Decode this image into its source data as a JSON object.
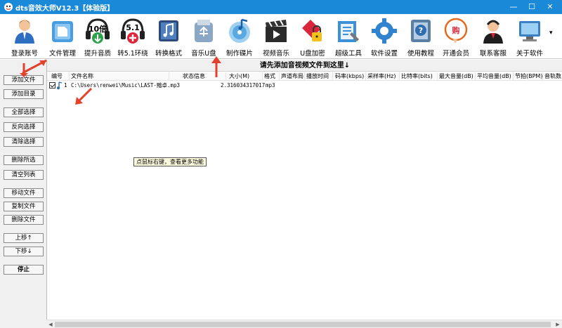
{
  "window": {
    "title": "dts音效大师V12.3【体验版】",
    "minimize_glyph": "—",
    "maximize_glyph": "☐",
    "close_glyph": "✕"
  },
  "toolbar": {
    "items": [
      {
        "label": "登录账号",
        "icon": "user-icon"
      },
      {
        "label": "文件管理",
        "icon": "folder-icon"
      },
      {
        "label": "提升音质",
        "icon": "headphones-10x-icon",
        "badge": "10倍"
      },
      {
        "label": "转5.1环绕",
        "icon": "headphones-51-icon",
        "badge": "5.1"
      },
      {
        "label": "转换格式",
        "icon": "music-note-icon"
      },
      {
        "label": "音乐U盘",
        "icon": "usb-drive-icon"
      },
      {
        "label": "制作碟片",
        "icon": "cd-disc-icon"
      },
      {
        "label": "视频音乐",
        "icon": "clapperboard-icon"
      },
      {
        "label": "U盘加密",
        "icon": "usb-lock-icon"
      },
      {
        "label": "超级工具",
        "icon": "toolbox-icon"
      },
      {
        "label": "软件设置",
        "icon": "gear-icon"
      },
      {
        "label": "使用教程",
        "icon": "help-book-icon"
      },
      {
        "label": "开通会员",
        "icon": "vip-buy-icon",
        "badge": "购"
      },
      {
        "label": "联系客服",
        "icon": "headset-agent-icon"
      },
      {
        "label": "关于软件",
        "icon": "computer-icon"
      }
    ],
    "dropdown_glyph": "▾"
  },
  "sidebar": {
    "buttons": [
      {
        "label": "添加文件"
      },
      {
        "label": "添加目录"
      },
      {
        "label": "全部选择"
      },
      {
        "label": "反向选择"
      },
      {
        "label": "清除选择"
      },
      {
        "label": "删除所选"
      },
      {
        "label": "清空列表"
      },
      {
        "label": "移动文件"
      },
      {
        "label": "复制文件"
      },
      {
        "label": "删除文件"
      },
      {
        "label": "上移↑"
      },
      {
        "label": "下移↓"
      },
      {
        "label": "停止"
      }
    ]
  },
  "main": {
    "hint": "请先添加音视频文件到这里↓",
    "columns": [
      "编号",
      "文件名称",
      "状态信息",
      "大小(M)",
      "格式",
      "声道布局",
      "播放时间",
      "码率(kbps)",
      "采样率(Hz)",
      "比特率(bits)",
      "最大音量(dB)",
      "平均音量(dB)",
      "节拍(BPM)",
      "音轨数"
    ],
    "rows": [
      {
        "checked": true,
        "index": "1",
        "filename": "C:\\Users\\renwei\\Music\\LAST-黯卓.mp3",
        "status": "",
        "size": "2.316034317017",
        "format": "mp3"
      }
    ]
  },
  "tooltip": "点鼠标右键，查看更多功能",
  "colors": {
    "titlebar": "#1989d8",
    "annotation_arrow": "#e3412c"
  }
}
